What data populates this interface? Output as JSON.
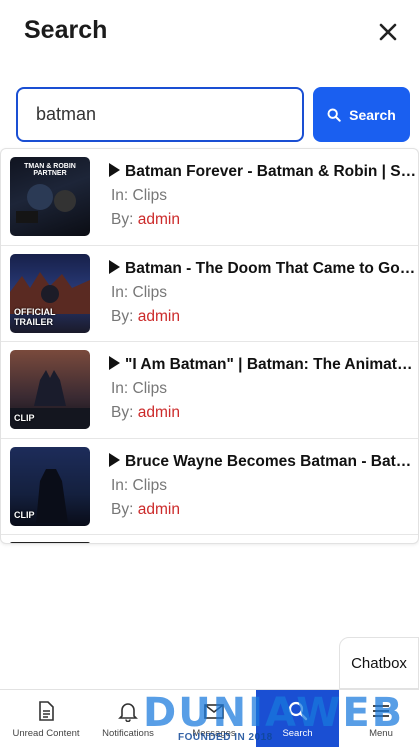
{
  "header": {
    "title": "Search"
  },
  "search": {
    "value": "batman",
    "button_label": "Search"
  },
  "results": [
    {
      "title": "Batman Forever - Batman & Robin | Su...",
      "in_label": "In: Clips",
      "by_label": "By:",
      "author": "admin",
      "thumb_top_text": "TMAN & ROBIN PARTNER",
      "thumb_caption": ""
    },
    {
      "title": "Batman - The Doom That Came to Got...",
      "in_label": "In: Clips",
      "by_label": "By:",
      "author": "admin",
      "thumb_top_text": "",
      "thumb_caption": "OFFICIAL TRAILER"
    },
    {
      "title": "\"I Am Batman\" | Batman: The Animate...",
      "in_label": "In: Clips",
      "by_label": "By:",
      "author": "admin",
      "thumb_top_text": "",
      "thumb_caption": "CLIP"
    },
    {
      "title": "Bruce Wayne Becomes Batman - Batm...",
      "in_label": "In: Clips",
      "by_label": "By:",
      "author": "admin",
      "thumb_top_text": "",
      "thumb_caption": "CLIP"
    }
  ],
  "chatbox": {
    "label": "Chatbox"
  },
  "bottom_nav": [
    {
      "label": "Unread Content",
      "icon": "document-icon"
    },
    {
      "label": "Notifications",
      "icon": "bell-icon"
    },
    {
      "label": "Messages",
      "icon": "envelope-icon"
    },
    {
      "label": "Search",
      "icon": "search-icon"
    },
    {
      "label": "Menu",
      "icon": "menu-icon"
    }
  ],
  "watermark": {
    "title": "DUNIAWEB",
    "subtitle": "FOUNDED IN 2018"
  },
  "colors": {
    "primary": "#1a4fd3",
    "button": "#1a5ff0",
    "author": "#cc2a2a"
  }
}
